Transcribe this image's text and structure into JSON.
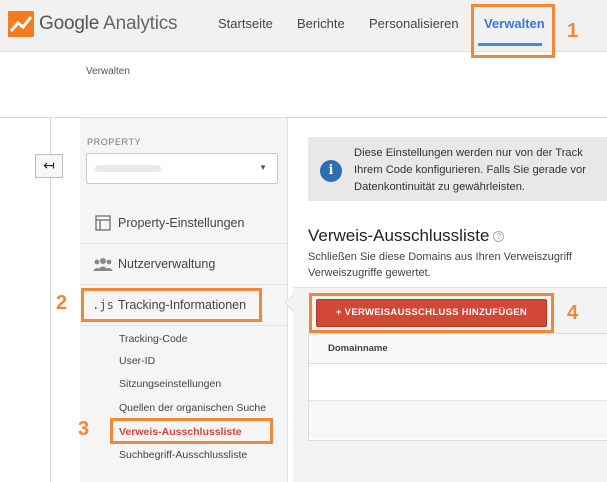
{
  "app": {
    "logo_text_1": "Google",
    "logo_text_2": " Analytics",
    "accent_color": "#f0883a",
    "brand_color": "#f47c20"
  },
  "nav": {
    "items": [
      {
        "label": "Startseite"
      },
      {
        "label": "Berichte"
      },
      {
        "label": "Personalisieren"
      },
      {
        "label": "Verwalten",
        "active": true
      }
    ]
  },
  "breadcrumb": "Verwalten",
  "sidebar": {
    "property_label": "PROPERTY",
    "items": [
      {
        "label": "Property-Einstellungen",
        "icon": "page-icon"
      },
      {
        "label": "Nutzerverwaltung",
        "icon": "users-icon"
      },
      {
        "label": "Tracking-Informationen",
        "icon": ".js"
      }
    ],
    "sub_items": [
      {
        "label": "Tracking-Code"
      },
      {
        "label": "User-ID"
      },
      {
        "label": "Sitzungseinstellungen"
      },
      {
        "label": "Quellen der organischen Suche"
      },
      {
        "label": "Verweis-Ausschlussliste",
        "active": true
      },
      {
        "label": "Suchbegriff-Ausschlussliste"
      }
    ]
  },
  "main": {
    "info_lines": [
      "Diese Einstellungen werden nur von der Track",
      "Ihrem Code konfigurieren. Falls Sie gerade vor",
      "Datenkontinuität zu gewährleisten."
    ],
    "title": "Verweis-Ausschlussliste",
    "help": "?",
    "desc_lines": [
      "Schließen Sie diese Domains aus Ihren Verweiszugriff",
      "Verweiszugriffe gewertet."
    ],
    "add_button": "+ VERWEISAUSSCHLUSS HINZUFÜGEN",
    "table_header": "Domainname"
  },
  "annotations": [
    "1",
    "2",
    "3",
    "4"
  ]
}
